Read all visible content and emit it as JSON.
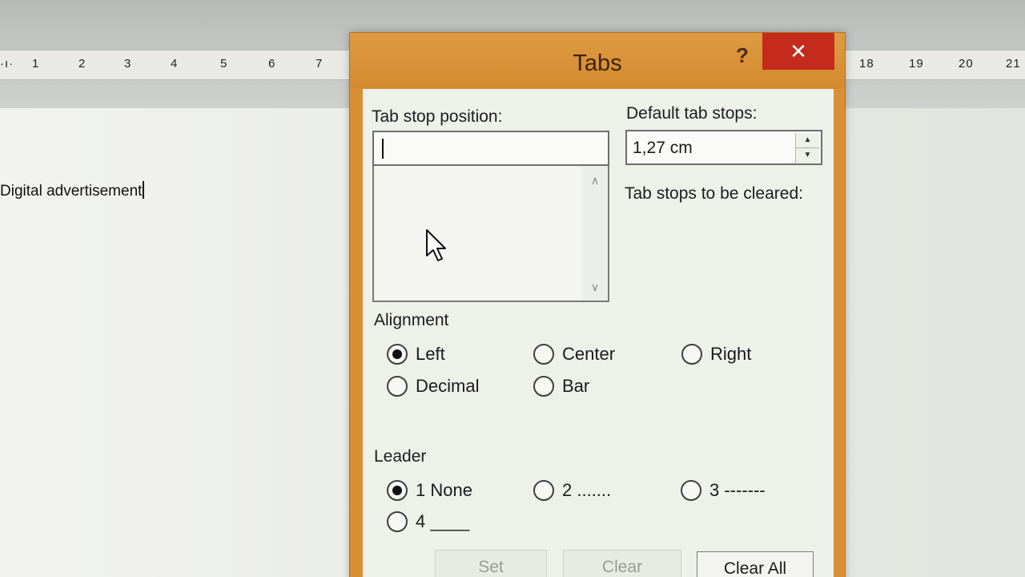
{
  "background": {
    "ruler_left": [
      "1",
      "2",
      "3",
      "4",
      "5",
      "6",
      "7"
    ],
    "ruler_right": [
      "18",
      "19",
      "20",
      "21"
    ],
    "document_text": "Digital advertisement"
  },
  "dialog": {
    "title": "Tabs",
    "help_label": "?",
    "close_label": "✕",
    "tab_stop_position_label": "Tab stop position:",
    "tab_stop_position_value": "",
    "tab_stops_list": [],
    "default_tab_stops_label": "Default tab stops:",
    "default_tab_stops_value": "1,27 cm",
    "tab_stops_cleared_label": "Tab stops to be cleared:",
    "alignment": {
      "label": "Alignment",
      "options": [
        "Left",
        "Center",
        "Right",
        "Decimal",
        "Bar"
      ],
      "selected": "Left"
    },
    "leader": {
      "label": "Leader",
      "options": [
        "1 None",
        "2 .......",
        "3 -------",
        "4 ____"
      ],
      "selected": "1 None"
    },
    "buttons": {
      "set": "Set",
      "clear": "Clear",
      "clear_all": "Clear All"
    }
  },
  "colors": {
    "title_bar": "#d98f33",
    "close_button": "#c42b1c",
    "dialog_client": "#eef0ea"
  }
}
